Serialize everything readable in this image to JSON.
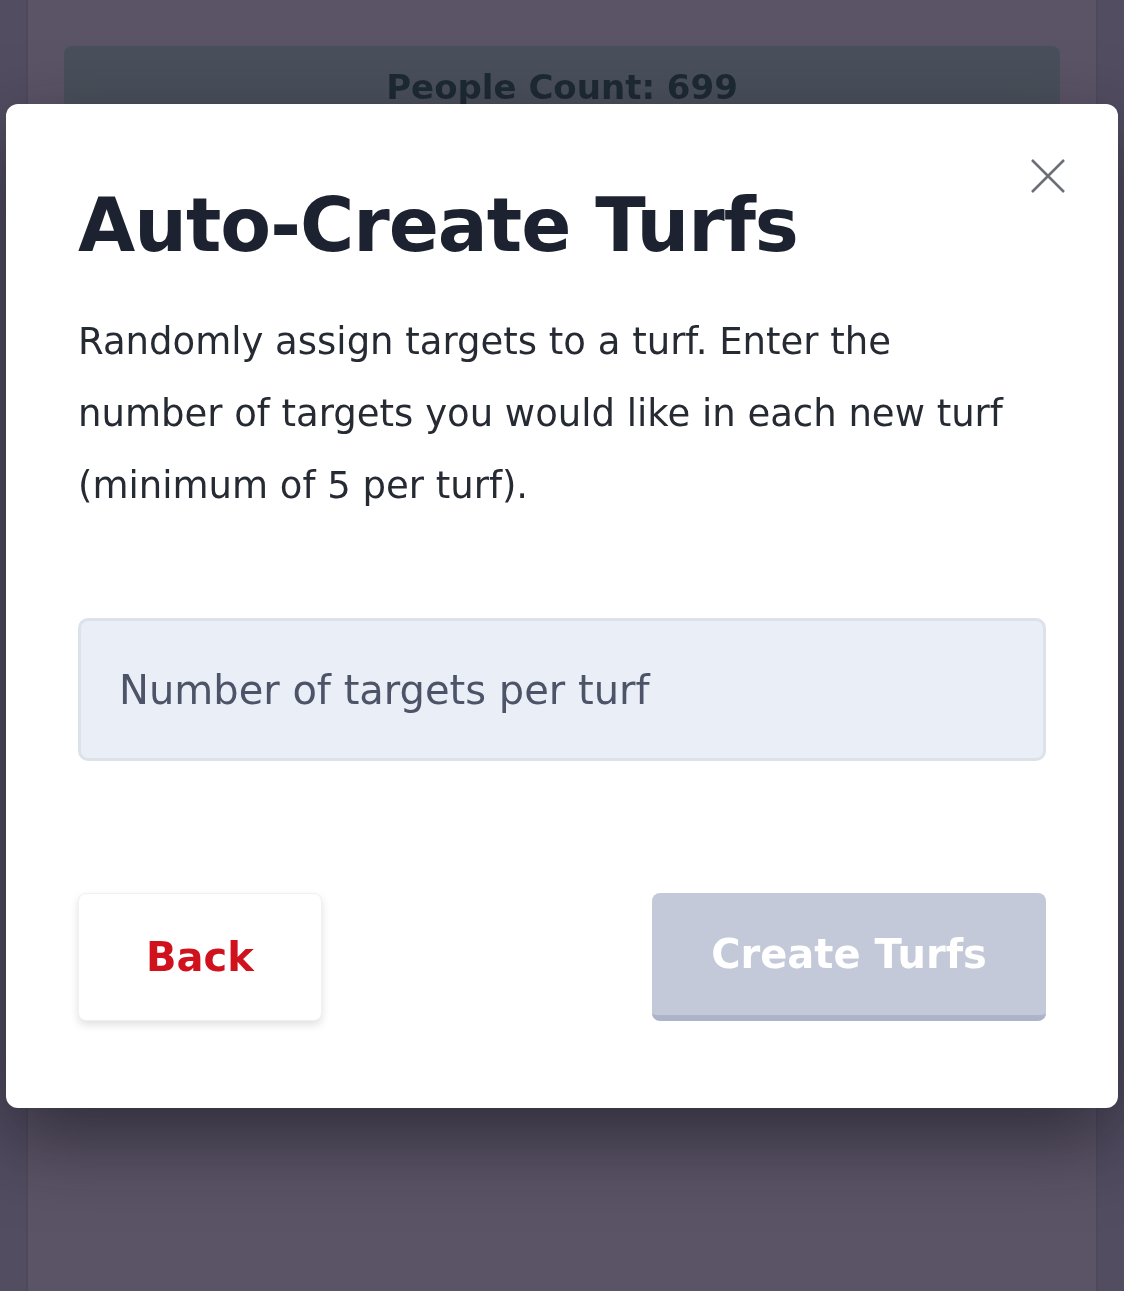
{
  "background": {
    "banner": "People Count: 699"
  },
  "dialog": {
    "title": "Auto-Create Turfs",
    "description": "Randomly assign targets to a turf. Enter the number of targets you would like in each new turf (minimum of 5 per turf).",
    "field": {
      "placeholder": "Number of targets per turf"
    },
    "back_button": "Back",
    "create_button": {
      "label": "Create Turfs",
      "disabled": true
    }
  }
}
